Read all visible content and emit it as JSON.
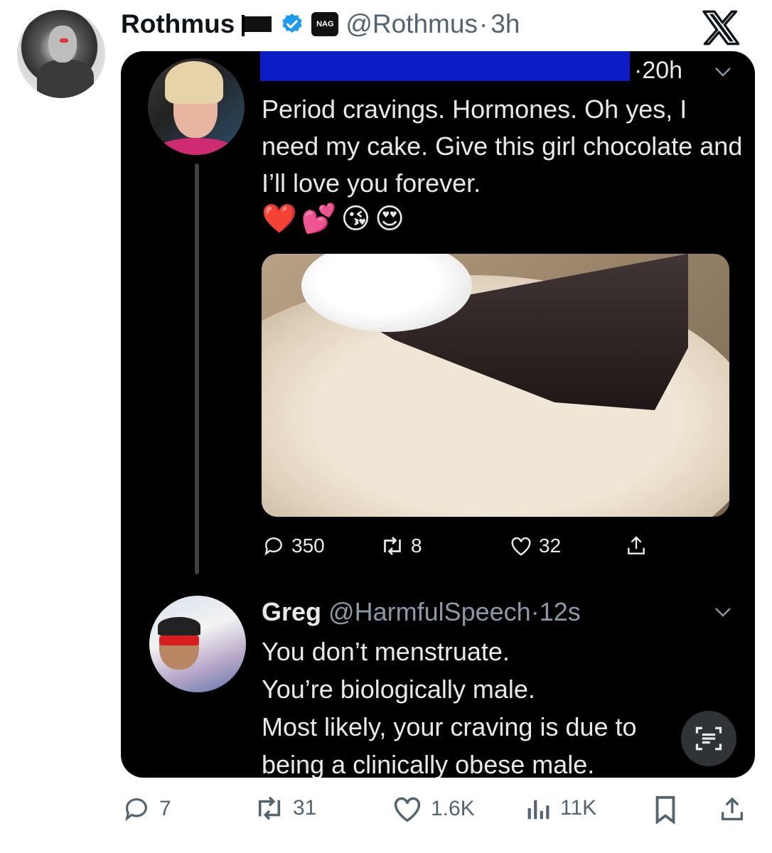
{
  "post": {
    "author_name": "Rothmus",
    "handle": "@Rothmus",
    "dot": "·",
    "time": "3h",
    "badge_text": "NAG",
    "metrics": {
      "replies": "7",
      "reposts": "31",
      "likes": "1.6K",
      "views": "11K"
    }
  },
  "quoted_thread": {
    "tweet1": {
      "time": "·20h",
      "text": "Period cravings. Hormones. Oh yes, I need my cake. Give this girl chocolate and I’ll love you forever.",
      "emojis": "❤️💕😘😍",
      "metrics": {
        "replies": "350",
        "reposts": "8",
        "likes": "32"
      }
    },
    "tweet2": {
      "author_name": "Greg",
      "handle": "@HarmfulSpeech",
      "dot": "·",
      "time": "12s",
      "lines": [
        "You don’t menstruate.",
        "You’re biologically male.",
        "Most likely, your craving is due to",
        "being a clinically obese male."
      ]
    }
  },
  "colors": {
    "background": "#ffffff",
    "card": "#000000",
    "verified": "#1d9bf0",
    "redaction": "#0b1cc7",
    "muted": "#536471"
  }
}
